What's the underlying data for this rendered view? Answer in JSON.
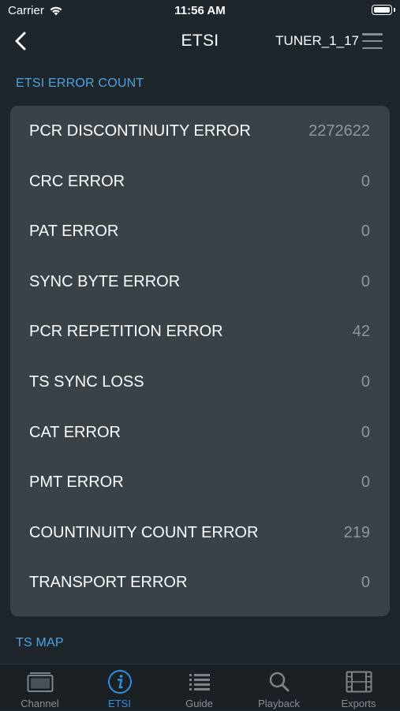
{
  "status_bar": {
    "carrier": "Carrier",
    "time": "11:56 AM",
    "battery_level": 1.0
  },
  "nav": {
    "title": "ETSI",
    "tuner": "TUNER_1_17"
  },
  "sections": {
    "etsi_error_count": "ETSI ERROR COUNT",
    "ts_map": "TS MAP"
  },
  "errors": [
    {
      "label": "PCR DISCONTINUITY ERROR",
      "value": "2272622"
    },
    {
      "label": "CRC ERROR",
      "value": "0"
    },
    {
      "label": "PAT ERROR",
      "value": "0"
    },
    {
      "label": "SYNC BYTE ERROR",
      "value": "0"
    },
    {
      "label": "PCR REPETITION ERROR",
      "value": "42"
    },
    {
      "label": "TS SYNC LOSS",
      "value": "0"
    },
    {
      "label": "CAT ERROR",
      "value": "0"
    },
    {
      "label": "PMT ERROR",
      "value": "0"
    },
    {
      "label": "COUNTINUITY COUNT ERROR",
      "value": "219"
    },
    {
      "label": "TRANSPORT ERROR",
      "value": "0"
    }
  ],
  "tabs": [
    {
      "label": "Channel",
      "icon": "tv-icon",
      "active": false
    },
    {
      "label": "ETSI",
      "icon": "info-icon",
      "active": true
    },
    {
      "label": "Guide",
      "icon": "list-icon",
      "active": false
    },
    {
      "label": "Playback",
      "icon": "search-icon",
      "active": false
    },
    {
      "label": "Exports",
      "icon": "film-icon",
      "active": false
    }
  ],
  "colors": {
    "background": "#1f262b",
    "card": "#3a4247",
    "accent": "#4aa3e0",
    "active_tab": "#2f8fe0",
    "value_text": "#8e959b"
  }
}
